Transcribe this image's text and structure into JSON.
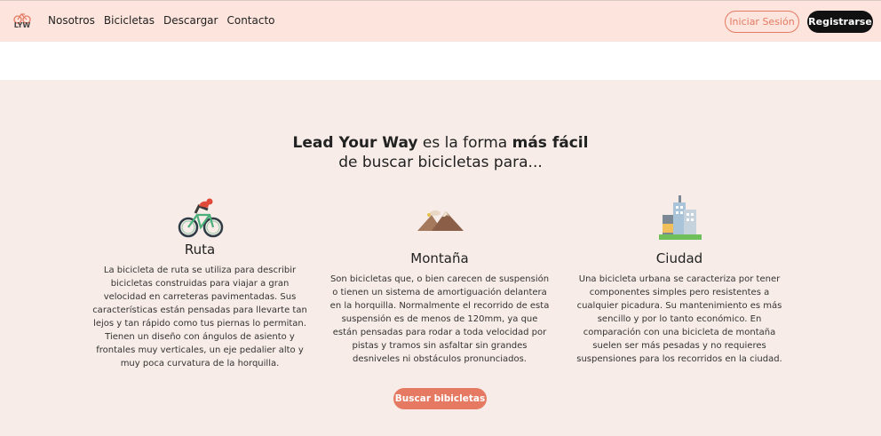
{
  "header": {
    "logo_text": "LYW",
    "nav": [
      "Nosotros",
      "Bicicletas",
      "Descargar",
      "Contacto"
    ],
    "login_label": "Iniciar Sesión",
    "register_label": "Registrarse"
  },
  "hero": {
    "line1_bold_a": "Lead Your Way",
    "line1_mid": " es la forma ",
    "line1_bold_b": "más fácil",
    "line2": "de buscar bicicletas para..."
  },
  "features": [
    {
      "title": "Ruta",
      "icon": "road-bike-icon",
      "text": "La bicicleta de ruta se utiliza para describir bicicletas construidas para viajar a gran velocidad en carreteras pavimentadas. Sus características están pensadas para llevarte tan lejos y tan rápido como tus piernas lo permitan. Tienen un diseño con ángulos de asiento y frontales muy verticales, un eje pedalier alto y muy poca curvatura de la horquilla."
    },
    {
      "title": "Montaña",
      "icon": "mountain-icon",
      "text": "Son bicicletas que, o bien carecen de suspensión o tienen un sistema de amortiguación delantera en la horquilla. Normalmente el recorrido de esta suspensión es de menos de 120mm, ya que están pensadas para rodar a toda velocidad por pistas y tramos sin asfaltar sin grandes desniveles ni obstáculos pronunciados."
    },
    {
      "title": "Ciudad",
      "icon": "city-icon",
      "text": "Una bicicleta urbana se caracteriza por tener componentes simples pero resistentes a cualquier picadura. Su mantenimiento es más sencillo y por lo tanto económico. En comparación con una bicicleta de montaña suelen ser más pesadas y no requieres suspensiones para los recorridos en la ciudad."
    }
  ],
  "cta_label": "Buscar bibicletas",
  "colors": {
    "header_bg": "#fde4dc",
    "section_bg": "#f7ece7",
    "accent": "#e57961"
  }
}
